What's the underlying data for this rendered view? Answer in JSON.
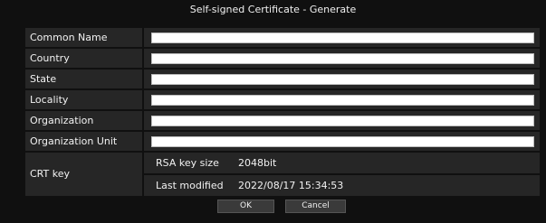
{
  "dialog": {
    "title": "Self-signed Certificate - Generate"
  },
  "fields": [
    {
      "label": "Common Name",
      "value": ""
    },
    {
      "label": "Country",
      "value": ""
    },
    {
      "label": "State",
      "value": ""
    },
    {
      "label": "Locality",
      "value": ""
    },
    {
      "label": "Organization",
      "value": ""
    },
    {
      "label": "Organization Unit",
      "value": ""
    }
  ],
  "crt": {
    "label": "CRT key",
    "rsa_key_size_label": "RSA key size",
    "rsa_key_size_value": "2048bit",
    "last_modified_label": "Last modified",
    "last_modified_value": "2022/08/17 15:34:53"
  },
  "buttons": {
    "ok": "OK",
    "cancel": "Cancel"
  }
}
